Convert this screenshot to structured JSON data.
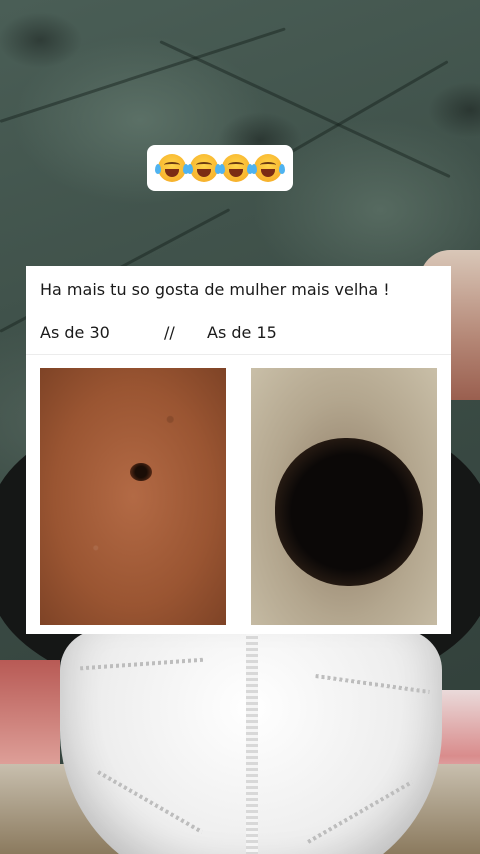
{
  "emoji_reaction": {
    "icons": [
      "tears-of-joy-emoji",
      "tears-of-joy-emoji",
      "tears-of-joy-emoji",
      "tears-of-joy-emoji"
    ]
  },
  "meme": {
    "caption": "Ha mais tu so gosta de mulher mais velha !",
    "left_label": "As de 30",
    "separator": "//",
    "right_label": "As de 15"
  },
  "colors": {
    "card_background": "#ffffff",
    "text": "#1a1a1a",
    "background_cushion": "#3f524b"
  }
}
